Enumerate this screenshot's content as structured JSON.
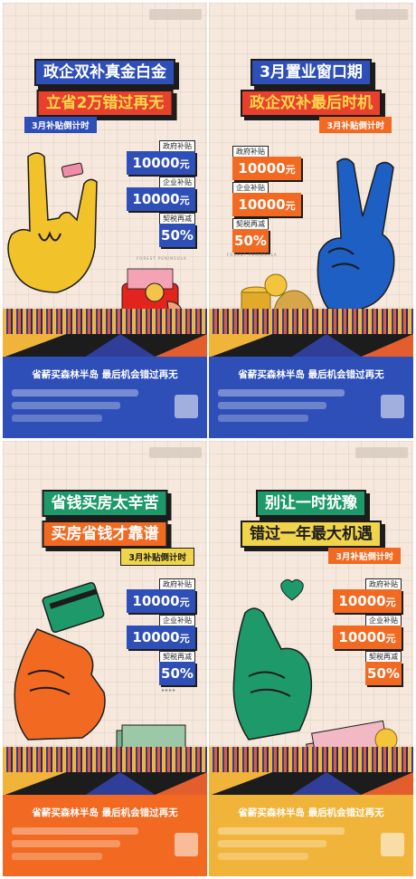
{
  "posters": [
    {
      "headline1": "政企双补真金白金",
      "headline2": "立省2万错过再无",
      "subtitle": "3月补贴倒计时",
      "amounts": [
        {
          "label": "政府补贴",
          "value": "10000",
          "unit": "元"
        },
        {
          "label": "企业补贴",
          "value": "10000",
          "unit": "元"
        },
        {
          "label": "契税再减",
          "value": "50%",
          "unit": ""
        }
      ],
      "brand_small": "FOREST PENINSULA",
      "footer_tagline": "省薪买森林半岛 最后机会错过再无"
    },
    {
      "headline1": "3月置业窗口期",
      "headline2": "政企双补最后时机",
      "subtitle": "3月补贴倒计时",
      "amounts": [
        {
          "label": "政府补贴",
          "value": "10000",
          "unit": "元"
        },
        {
          "label": "企业补贴",
          "value": "10000",
          "unit": "元"
        },
        {
          "label": "契税再减",
          "value": "50%",
          "unit": ""
        }
      ],
      "brand_small": "FOREST PENINSULA",
      "footer_tagline": "省薪买森林半岛 最后机会错过再无"
    },
    {
      "headline1": "省钱买房太辛苦",
      "headline2": "买房省钱才靠谱",
      "subtitle": "3月补贴倒计时",
      "amounts": [
        {
          "label": "政府补贴",
          "value": "10000",
          "unit": "元"
        },
        {
          "label": "企业补贴",
          "value": "10000",
          "unit": "元"
        },
        {
          "label": "契税再减",
          "value": "50%",
          "unit": ""
        }
      ],
      "brand_small": "FOREST PENINSULA",
      "footer_tagline": "省薪买森林半岛 最后机会错过再无"
    },
    {
      "headline1": "别让一时犹豫",
      "headline2": "错过一年最大机遇",
      "subtitle": "3月补贴倒计时",
      "amounts": [
        {
          "label": "政府补贴",
          "value": "10000",
          "unit": "元"
        },
        {
          "label": "企业补贴",
          "value": "10000",
          "unit": "元"
        },
        {
          "label": "契税再减",
          "value": "50%",
          "unit": ""
        }
      ],
      "brand_small": "FOREST PENINSULA",
      "footer_tagline": "省薪买森林半岛 最后机会错过再无"
    }
  ],
  "colors": {
    "background": "#f6e8dc",
    "yellow": "#f1b43a",
    "blue": "#2f4fb8",
    "orange": "#f26a22",
    "red": "#e8402c",
    "green": "#1e9a6a",
    "dark": "#1c1c1c"
  },
  "icons": [
    "hand-rock-icon",
    "hand-peace-icon",
    "hand-card-icon",
    "hand-heart-icon",
    "coin-stack-icon",
    "red-envelope-icon",
    "cash-stack-icon"
  ]
}
